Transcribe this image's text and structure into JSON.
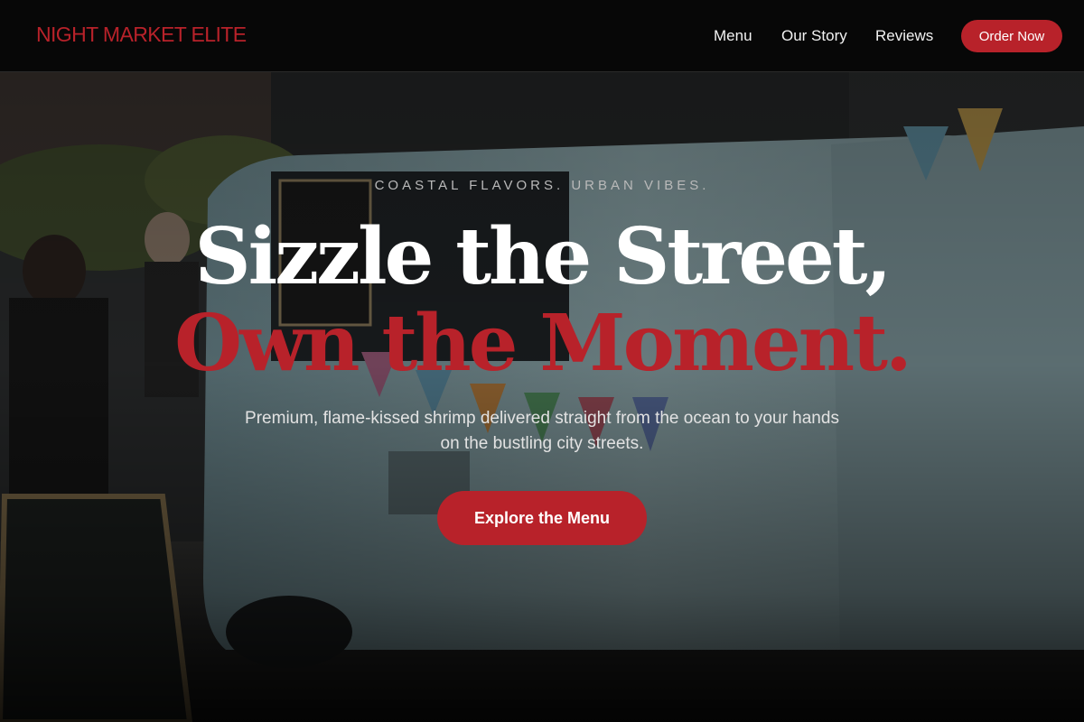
{
  "nav": {
    "logo": "NIGHT MARKET ELITE",
    "links": [
      "Menu",
      "Our Story",
      "Reviews"
    ],
    "cta": "Order Now"
  },
  "hero": {
    "eyebrow": "COASTAL FLAVORS. URBAN VIBES.",
    "headline_line1": "Sizzle the Street,",
    "headline_line2": "Own the Moment.",
    "subheadline": "Premium, flame-kissed shrimp delivered straight from the ocean to your hands on the bustling city streets.",
    "cta": "Explore the Menu",
    "background_image": "food-truck-street-market-photo"
  },
  "colors": {
    "brand_red": "#b8222a",
    "nav_bg": "#070707",
    "text_light": "#ffffff"
  }
}
